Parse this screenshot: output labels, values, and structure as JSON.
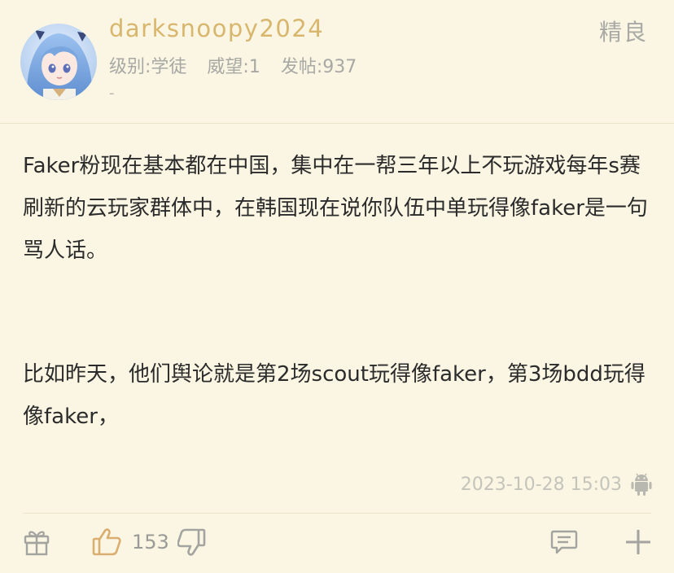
{
  "user": {
    "name": "darksnoopy2024",
    "level": "级别:学徒",
    "prestige": "威望:1",
    "posts": "发帖:937",
    "signature": "-"
  },
  "badge": "精良",
  "content": {
    "paragraph1": "Faker粉现在基本都在中国，集中在一帮三年以上不玩游戏每年s赛刷新的云玩家群体中，在韩国现在说你队伍中单玩得像faker是一句骂人话。",
    "paragraph2": "比如昨天，他们舆论就是第2场scout玩得像faker，第3场bdd玩得像faker，"
  },
  "meta": {
    "timestamp": "2023-10-28 15:03",
    "platform_icon": "android-icon"
  },
  "actions": {
    "like_count": "153",
    "gift_icon": "gift-icon",
    "like_icon": "thumbs-up-icon",
    "dislike_icon": "thumbs-down-icon",
    "comment_icon": "comment-icon",
    "add_icon": "plus-icon"
  },
  "colors": {
    "background": "#faf6e3",
    "username": "#d8b66d",
    "like_accent": "#d9ae6e",
    "muted": "#a8a8a4"
  }
}
